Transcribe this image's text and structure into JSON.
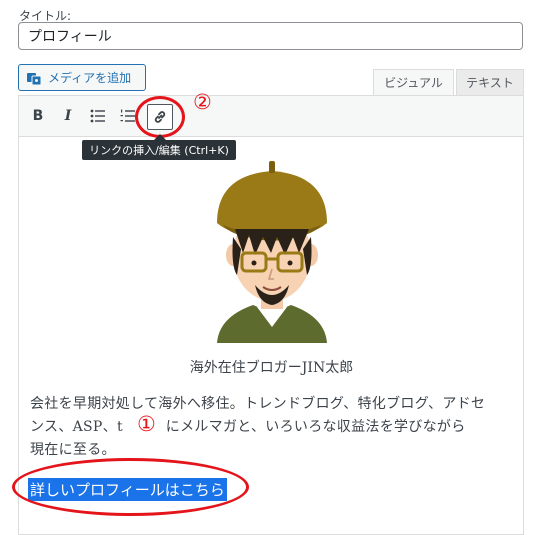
{
  "title_field": {
    "label": "タイトル:",
    "value": "プロフィール"
  },
  "media_button": {
    "label": "メディアを追加",
    "icon": "media-add-icon"
  },
  "editor_tabs": [
    {
      "label": "ビジュアル",
      "active": true
    },
    {
      "label": "テキスト",
      "active": false
    }
  ],
  "toolbar": {
    "bold_label": "B",
    "italic_label": "I",
    "buttons": [
      "bold-icon",
      "italic-icon",
      "bullet-list-icon",
      "numbered-list-icon",
      "link-icon"
    ],
    "link_tooltip": "リンクの挿入/編集 (Ctrl+K)"
  },
  "content": {
    "caption": "海外在住ブロガーJIN太郎",
    "paragraph_line1": "会社を早期対処して海外へ移住。トレンドブログ、特化ブログ、アドセ",
    "paragraph_line2": "ンス、ASP、t　　　にメルマガと、いろいろな収益法を学びながら",
    "paragraph_line3": "現在に至る。",
    "selected_link": "詳しいプロフィールはこちら"
  },
  "annotations": {
    "marker_1": "①",
    "marker_2": "②"
  },
  "colors": {
    "accent_blue": "#2271b1",
    "annotation_red": "#e4141b",
    "selection_blue": "#1a73e8",
    "tooltip_bg": "#2c3338"
  }
}
